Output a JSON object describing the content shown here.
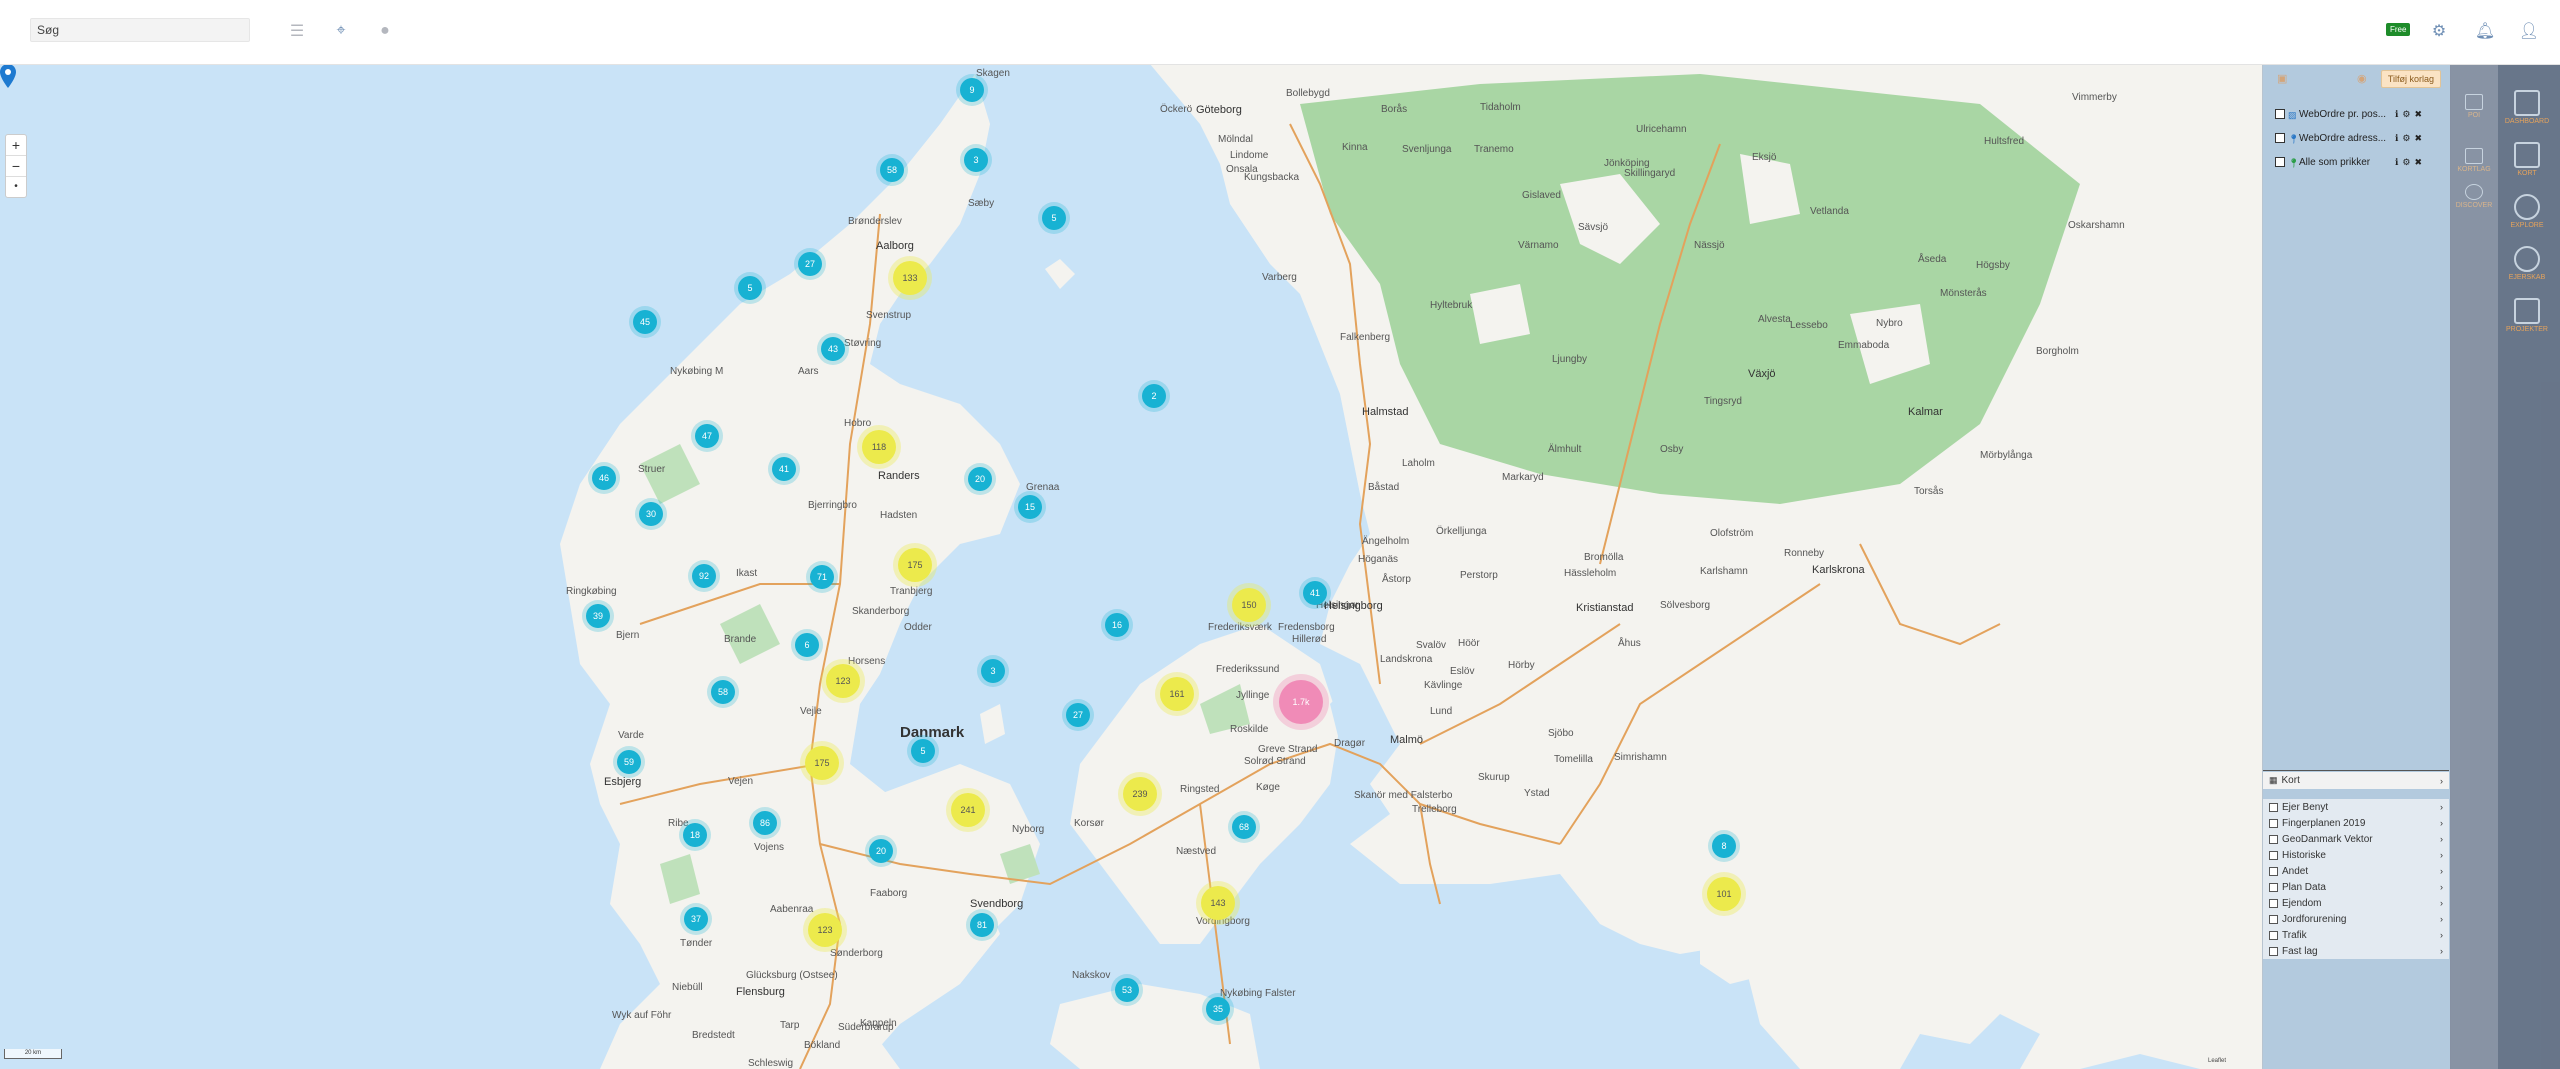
{
  "topbar": {
    "search_placeholder": "Søg",
    "badge": "Free",
    "icons": [
      "menu-icon",
      "location-pin-icon",
      "record-icon",
      "gear-icon",
      "bell-icon",
      "user-icon"
    ]
  },
  "map": {
    "zoom": {
      "in": "+",
      "out": "−",
      "reset": "•"
    },
    "scale": "20 km",
    "attribution": "Leaflet",
    "places": [
      {
        "label": "Skagen"
      },
      {
        "label": "Brønderslev"
      },
      {
        "label": "Sæby"
      },
      {
        "label": "Aalborg"
      },
      {
        "label": "Svenstrup"
      },
      {
        "label": "Støvring"
      },
      {
        "label": "Aars"
      },
      {
        "label": "Nykøbing M"
      },
      {
        "label": "Hobro"
      },
      {
        "label": "Struer"
      },
      {
        "label": "Randers"
      },
      {
        "label": "Bjerringbro"
      },
      {
        "label": "Hadsten"
      },
      {
        "label": "Grenaa"
      },
      {
        "label": "Ikast"
      },
      {
        "label": "Ringkøbing"
      },
      {
        "label": "Tranbjerg"
      },
      {
        "label": "Skanderborg"
      },
      {
        "label": "Odder"
      },
      {
        "label": "Bjern"
      },
      {
        "label": "Brande"
      },
      {
        "label": "Horsens"
      },
      {
        "label": "Vejle"
      },
      {
        "label": "Varde"
      },
      {
        "label": "Esbjerg"
      },
      {
        "label": "Vejen"
      },
      {
        "label": "Ribe"
      },
      {
        "label": "Vojens"
      },
      {
        "label": "Aabenraa"
      },
      {
        "label": "Tønder"
      },
      {
        "label": "Sønderborg"
      },
      {
        "label": "Niebüll"
      },
      {
        "label": "Flensburg"
      },
      {
        "label": "Wyk auf Föhr"
      },
      {
        "label": "Bredstedt"
      },
      {
        "label": "Tarp"
      },
      {
        "label": "Süderbrarup"
      },
      {
        "label": "Kappeln"
      },
      {
        "label": "Glücksburg (Ostsee)"
      },
      {
        "label": "Bökland"
      },
      {
        "label": "Schleswig"
      },
      {
        "label": "Faaborg"
      },
      {
        "label": "Svendborg"
      },
      {
        "label": "Nyborg"
      },
      {
        "label": "Korsør"
      },
      {
        "label": "Ringsted"
      },
      {
        "label": "Køge"
      },
      {
        "label": "Næstved"
      },
      {
        "label": "Vordingborg"
      },
      {
        "label": "Nakskov"
      },
      {
        "label": "Nykøbing Falster"
      },
      {
        "label": "Roskilde"
      },
      {
        "label": "Greve Strand"
      },
      {
        "label": "Solrød Strand"
      },
      {
        "label": "Jyllinge"
      },
      {
        "label": "Frederikssund"
      },
      {
        "label": "Hillerød"
      },
      {
        "label": "Fredensborg"
      },
      {
        "label": "Frederiksværk"
      },
      {
        "label": "Helsingør"
      },
      {
        "label": "Helsingborg"
      },
      {
        "label": "Landskrona"
      },
      {
        "label": "Lund"
      },
      {
        "label": "Malmö"
      },
      {
        "label": "Dragør"
      },
      {
        "label": "Skanör med Falsterbo"
      },
      {
        "label": "Trelleborg"
      },
      {
        "label": "Skurup"
      },
      {
        "label": "Ystad"
      },
      {
        "label": "Tomelilla"
      },
      {
        "label": "Simrishamn"
      },
      {
        "label": "Sjöbo"
      },
      {
        "label": "Hörby"
      },
      {
        "label": "Eslöv"
      },
      {
        "label": "Kävlinge"
      },
      {
        "label": "Svalöv"
      },
      {
        "label": "Höör"
      },
      {
        "label": "Kristianstad"
      },
      {
        "label": "Åhus"
      },
      {
        "label": "Sölvesborg"
      },
      {
        "label": "Karlshamn"
      },
      {
        "label": "Ronneby"
      },
      {
        "label": "Karlskrona"
      },
      {
        "label": "Olofström"
      },
      {
        "label": "Bromölla"
      },
      {
        "label": "Hässleholm"
      },
      {
        "label": "Perstorp"
      },
      {
        "label": "Örkelljunga"
      },
      {
        "label": "Ängelholm"
      },
      {
        "label": "Höganäs"
      },
      {
        "label": "Åstorp"
      },
      {
        "label": "Båstad"
      },
      {
        "label": "Laholm"
      },
      {
        "label": "Halmstad"
      },
      {
        "label": "Falkenberg"
      },
      {
        "label": "Varberg"
      },
      {
        "label": "Kungsbacka"
      },
      {
        "label": "Onsala"
      },
      {
        "label": "Lindome"
      },
      {
        "label": "Mölndal"
      },
      {
        "label": "Göteborg"
      },
      {
        "label": "Borås"
      },
      {
        "label": "Öckerö"
      },
      {
        "label": "Kinna"
      },
      {
        "label": "Svenljunga"
      },
      {
        "label": "Tranemo"
      },
      {
        "label": "Gislaved"
      },
      {
        "label": "Värnamo"
      },
      {
        "label": "Hyltebruk"
      },
      {
        "label": "Ljungby"
      },
      {
        "label": "Markaryd"
      },
      {
        "label": "Älmhult"
      },
      {
        "label": "Osby"
      },
      {
        "label": "Tingsryd"
      },
      {
        "label": "Växjö"
      },
      {
        "label": "Alvesta"
      },
      {
        "label": "Lessebo"
      },
      {
        "label": "Emmaboda"
      },
      {
        "label": "Nybro"
      },
      {
        "label": "Kalmar"
      },
      {
        "label": "Mörbylånga"
      },
      {
        "label": "Torsås"
      },
      {
        "label": "Borgholm"
      },
      {
        "label": "Mönsterås"
      },
      {
        "label": "Oskarshamn"
      },
      {
        "label": "Högsby"
      },
      {
        "label": "Åseda"
      },
      {
        "label": "Hultsfred"
      },
      {
        "label": "Vimmerby"
      },
      {
        "label": "Eksjö"
      },
      {
        "label": "Vetlanda"
      },
      {
        "label": "Sävsjö"
      },
      {
        "label": "Nässjö"
      },
      {
        "label": "Skillingaryd"
      },
      {
        "label": "Jönköping"
      },
      {
        "label": "Ulricehamn"
      },
      {
        "label": "Tidaholm"
      },
      {
        "label": "Bollebygd"
      },
      {
        "label": "Danmark"
      }
    ],
    "clusters": [
      {
        "label": "9",
        "size": "s"
      },
      {
        "label": "3",
        "size": "s"
      },
      {
        "label": "58",
        "size": "s"
      },
      {
        "label": "5",
        "size": "s"
      },
      {
        "label": "27",
        "size": "s"
      },
      {
        "label": "133",
        "size": "m"
      },
      {
        "label": "5",
        "size": "s"
      },
      {
        "label": "45",
        "size": "s"
      },
      {
        "label": "43",
        "size": "s"
      },
      {
        "label": "2",
        "size": "s"
      },
      {
        "label": "118",
        "size": "m"
      },
      {
        "label": "47",
        "size": "s"
      },
      {
        "label": "46",
        "size": "s"
      },
      {
        "label": "41",
        "size": "s"
      },
      {
        "label": "20",
        "size": "s"
      },
      {
        "label": "15",
        "size": "s"
      },
      {
        "label": "30",
        "size": "s"
      },
      {
        "label": "175",
        "size": "m"
      },
      {
        "label": "92",
        "size": "s"
      },
      {
        "label": "71",
        "size": "s"
      },
      {
        "label": "39",
        "size": "s"
      },
      {
        "label": "150",
        "size": "m"
      },
      {
        "label": "41",
        "size": "s"
      },
      {
        "label": "16",
        "size": "s"
      },
      {
        "label": "6",
        "size": "s"
      },
      {
        "label": "3",
        "size": "s"
      },
      {
        "label": "123",
        "size": "m"
      },
      {
        "label": "58",
        "size": "s"
      },
      {
        "label": "161",
        "size": "m"
      },
      {
        "label": "1.7k",
        "size": "l"
      },
      {
        "label": "27",
        "size": "s"
      },
      {
        "label": "5",
        "size": "s"
      },
      {
        "label": "59",
        "size": "s"
      },
      {
        "label": "175",
        "size": "m"
      },
      {
        "label": "241",
        "size": "m"
      },
      {
        "label": "239",
        "size": "m"
      },
      {
        "label": "86",
        "size": "s"
      },
      {
        "label": "18",
        "size": "s"
      },
      {
        "label": "20",
        "size": "s"
      },
      {
        "label": "68",
        "size": "s"
      },
      {
        "label": "8",
        "size": "s"
      },
      {
        "label": "143",
        "size": "m"
      },
      {
        "label": "101",
        "size": "m"
      },
      {
        "label": "37",
        "size": "s"
      },
      {
        "label": "123",
        "size": "m"
      },
      {
        "label": "81",
        "size": "s"
      },
      {
        "label": "53",
        "size": "s"
      },
      {
        "label": "35",
        "size": "s"
      }
    ]
  },
  "panel": {
    "add_layer": "Tilføj korlag",
    "layers": [
      {
        "name": "WebOrdre pr. pos..."
      },
      {
        "name": "WebOrdre adress..."
      },
      {
        "name": "Alle som prikker"
      }
    ],
    "kort_title": "Kort",
    "kort_items": [
      "Ejer Benyt",
      "Fingerplanen 2019",
      "GeoDanmark Vektor",
      "Historiske",
      "Andet",
      "Plan Data",
      "Ejendom",
      "Jordforurening",
      "Trafik",
      "Fast lag"
    ]
  },
  "nav": {
    "mini": [
      {
        "label": "POI"
      },
      {
        "label": "KORTLAG"
      },
      {
        "label": "DISCOVER"
      }
    ],
    "items": [
      {
        "label": "DASHBOARD",
        "icon": "dashboard-icon"
      },
      {
        "label": "KORT",
        "icon": "map-icon"
      },
      {
        "label": "EXPLORE",
        "icon": "rocket-icon"
      },
      {
        "label": "EJERSKAB",
        "icon": "share-icon"
      },
      {
        "label": "PROJEKTER",
        "icon": "clipboard-icon"
      }
    ]
  },
  "colors": {
    "sea": "#c9e3f7",
    "land": "#f4f3ef",
    "forest": "#a9d6a4",
    "cluster_small": "#18b2d3",
    "cluster_medium": "#ecea4c",
    "cluster_large": "#f08bb7",
    "road": "#e3a25c"
  }
}
